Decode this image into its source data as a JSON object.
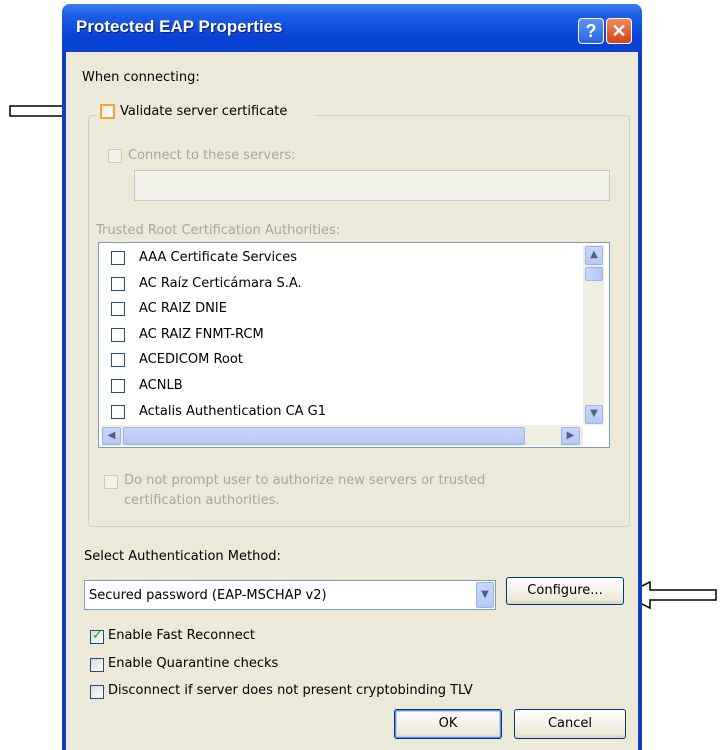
{
  "window": {
    "title": "Protected EAP Properties",
    "help_glyph": "?",
    "close_glyph": "✕"
  },
  "when_connecting": "When connecting:",
  "validate_server_cert": {
    "label": "Validate server certificate",
    "checked": false
  },
  "connect_to_servers": {
    "label": "Connect to these servers:",
    "checked": false,
    "value": ""
  },
  "trusted_root_label": "Trusted Root Certification Authorities:",
  "trusted_root_list": [
    {
      "label": "AAA Certificate Services",
      "checked": false
    },
    {
      "label": "AC Raíz Certicámara S.A.",
      "checked": false
    },
    {
      "label": "AC RAIZ DNIE",
      "checked": false
    },
    {
      "label": "AC RAIZ FNMT-RCM",
      "checked": false
    },
    {
      "label": "ACEDICOM Root",
      "checked": false
    },
    {
      "label": "ACNLB",
      "checked": false
    },
    {
      "label": "Actalis Authentication CA G1",
      "checked": false
    }
  ],
  "do_not_prompt": {
    "line1": "Do not prompt user to authorize new servers or trusted",
    "line2": "certification authorities.",
    "checked": false
  },
  "auth_method": {
    "label": "Select Authentication Method:",
    "selected": "Secured password (EAP-MSCHAP v2)",
    "configure": "Configure..."
  },
  "options": {
    "fast_reconnect": {
      "label": "Enable Fast Reconnect",
      "checked": true
    },
    "quarantine": {
      "label": "Enable Quarantine checks",
      "checked": false
    },
    "cryptobinding": {
      "label": "Disconnect if server does not present cryptobinding TLV",
      "checked": false
    }
  },
  "buttons": {
    "ok": "OK",
    "cancel": "Cancel"
  },
  "colors": {
    "title_bar": "#0a3fc9",
    "dialog_bg": "#ece9d8",
    "highlight_checkbox": "#f3a33a"
  }
}
